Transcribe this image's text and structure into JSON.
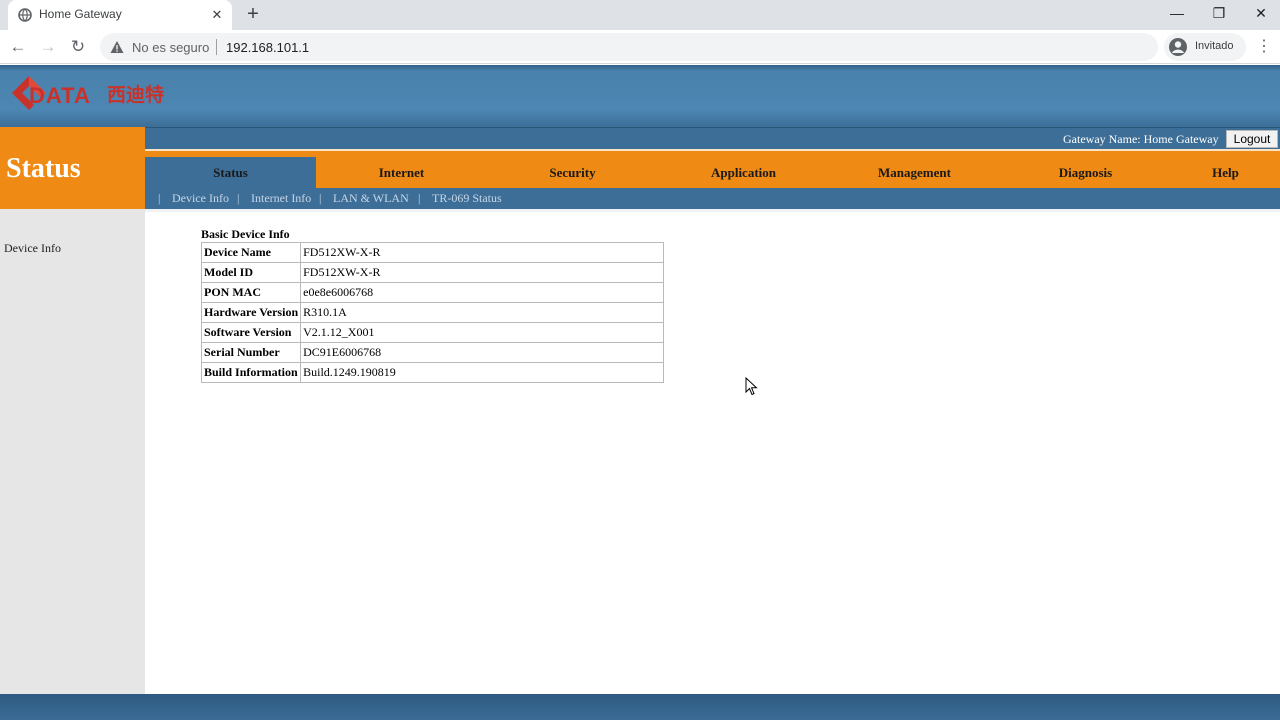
{
  "browser": {
    "tab_title": "Home Gateway",
    "tab_close": "✕",
    "new_tab": "+",
    "window": {
      "minimize": "—",
      "restore": "❐",
      "close": "✕"
    },
    "nav": {
      "back": "←",
      "forward": "→",
      "reload": "↻"
    },
    "security_label": "No es seguro",
    "url": "192.168.101.1",
    "profile_label": "Invitado",
    "menu": "⋮"
  },
  "site": {
    "logo_text": "C-DATA 西迪特",
    "page_title": "Status",
    "gateway_name": "Gateway Name: Home Gateway",
    "logout_label": "Logout",
    "main_nav": [
      {
        "label": "Status",
        "active": true
      },
      {
        "label": "Internet",
        "active": false
      },
      {
        "label": "Security",
        "active": false
      },
      {
        "label": "Application",
        "active": false
      },
      {
        "label": "Management",
        "active": false
      },
      {
        "label": "Diagnosis",
        "active": false
      },
      {
        "label": "Help",
        "active": false
      }
    ],
    "sub_nav": [
      "Device Info",
      "Internet Info",
      "LAN & WLAN",
      "TR-069 Status"
    ],
    "sub_nav_separator": "|",
    "sidebar_items": [
      "Device Info"
    ]
  },
  "device_info": {
    "title": "Basic Device Info",
    "rows": [
      {
        "label": "Device Name",
        "value": "FD512XW-X-R"
      },
      {
        "label": "Model ID",
        "value": "FD512XW-X-R"
      },
      {
        "label": "PON MAC",
        "value": "e0e8e6006768"
      },
      {
        "label": "Hardware Version",
        "value": "R310.1A"
      },
      {
        "label": "Software Version",
        "value": "V2.1.12_X001"
      },
      {
        "label": "Serial Number",
        "value": "DC91E6006768"
      },
      {
        "label": "Build Information",
        "value": "Build.1249.190819"
      }
    ]
  },
  "colors": {
    "orange": "#ef8a14",
    "blue": "#3d6e98",
    "header_blue": "#4d86b2"
  }
}
